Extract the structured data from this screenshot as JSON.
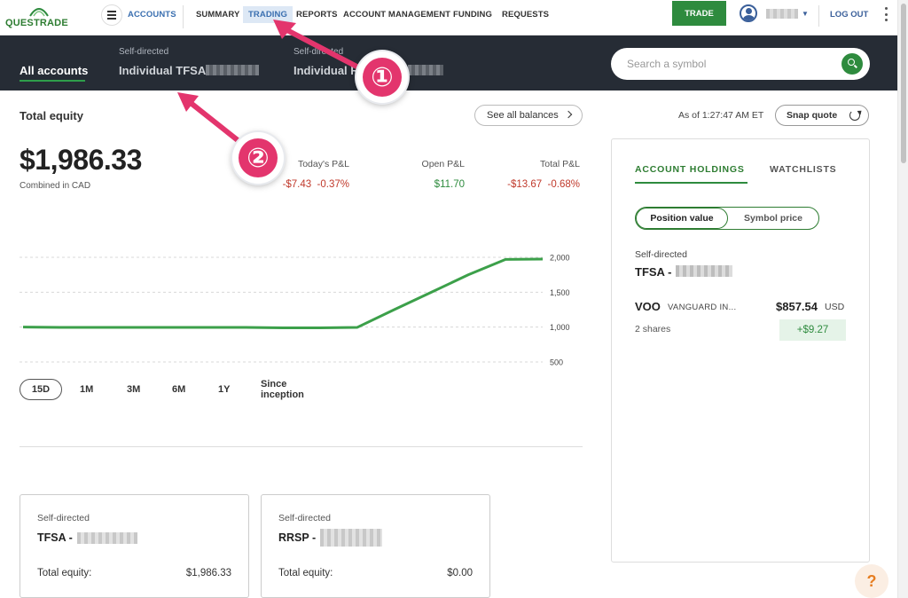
{
  "brand": {
    "logo_text": "QUESTRADE",
    "accent": "#2e8b3e",
    "dark_bar": "#262c35",
    "negative": "#c0392b",
    "annotation": "#e3356d"
  },
  "topnav": {
    "menu_icon": "hamburger-icon",
    "accounts": "ACCOUNTS",
    "summary": "SUMMARY",
    "trading": "TRADING",
    "reports": "REPORTS",
    "account_management": "ACCOUNT MANAGEMENT",
    "funding": "FUNDING",
    "requests": "REQUESTS",
    "trade_button": "TRADE",
    "logout": "LOG OUT"
  },
  "accounts_bar": {
    "all_accounts": "All accounts",
    "tabs": [
      {
        "sub": "Self-directed",
        "name": "Individual TFSA"
      },
      {
        "sub": "Self-directed",
        "name": "Individual R"
      }
    ],
    "search_placeholder": "Search a symbol"
  },
  "summary": {
    "title": "Total equity",
    "see_all_balances": "See all balances",
    "equity_value": "$1,986.33",
    "equity_sub": "Combined in CAD",
    "todays_pl_label": "Today's P&L",
    "todays_pl_value": "-$7.43  -0.37%",
    "open_pl_label": "Open P&L",
    "open_pl_value": "$11.70",
    "total_pl_label": "Total P&L",
    "total_pl_value": "-$13.67  -0.68%"
  },
  "chart_data": {
    "type": "line",
    "x": [
      1,
      2,
      3,
      4,
      5,
      6,
      7,
      8,
      9,
      10,
      11,
      12,
      13,
      14,
      15
    ],
    "series": [
      {
        "values": [
          1000,
          995,
          995,
          995,
          995,
          995,
          995,
          990,
          990,
          995,
          1250,
          1500,
          1750,
          1970,
          1975
        ]
      }
    ],
    "yticks": [
      "2,000",
      "1,500",
      "1,000",
      "500"
    ],
    "ylim": [
      500,
      2000
    ],
    "grid": true,
    "line_color": "#3ca04a"
  },
  "ranges": [
    "15D",
    "1M",
    "3M",
    "6M",
    "1Y",
    "Since inception"
  ],
  "cards": [
    {
      "sub": "Self-directed",
      "name": "TFSA -",
      "total_label": "Total equity:",
      "total_value": "$1,986.33"
    },
    {
      "sub": "Self-directed",
      "name": "RRSP -",
      "total_label": "Total equity:",
      "total_value": "$0.00"
    }
  ],
  "right_panel": {
    "as_of": "As of 1:27:47 AM ET",
    "snap_quote": "Snap quote",
    "tab_holdings": "ACCOUNT HOLDINGS",
    "tab_watchlists": "WATCHLISTS",
    "seg_position": "Position value",
    "seg_symbol": "Symbol price",
    "account_sub": "Self-directed",
    "account_name": "TFSA -",
    "holding": {
      "symbol": "VOO",
      "description": "VANGUARD IN...",
      "value": "$857.54",
      "currency": "USD",
      "shares": "2 shares",
      "change": "+$9.27"
    }
  },
  "annotations": {
    "badge1": "①",
    "badge2": "②"
  },
  "help": "?"
}
